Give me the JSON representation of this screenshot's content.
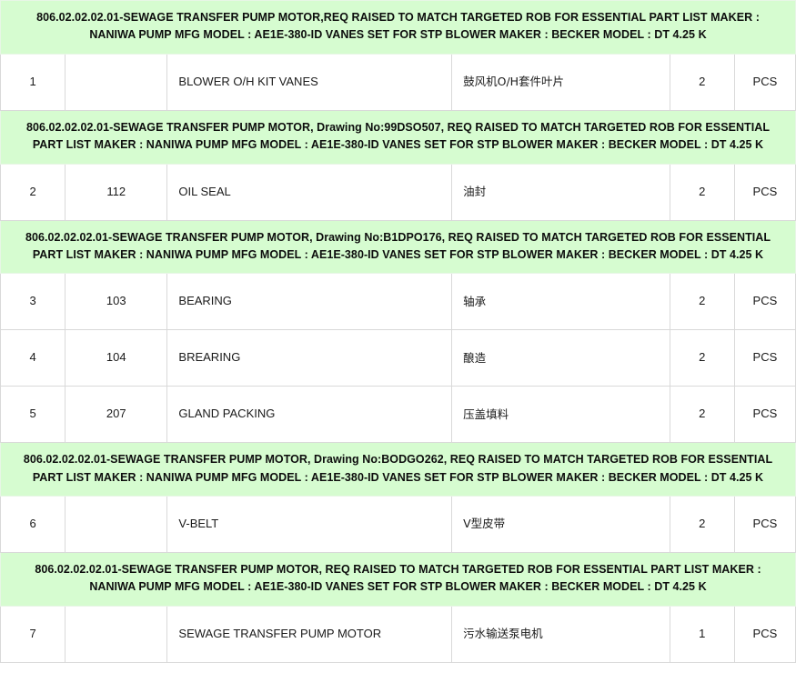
{
  "document": {
    "type": "parts-requisition-table",
    "colors": {
      "group_header_background": "#d6fcd0",
      "row_background": "#ffffff",
      "row_border": "#d9d9d9",
      "text": "#1a1a1a"
    }
  },
  "columns": [
    {
      "key": "line",
      "label": ""
    },
    {
      "key": "item",
      "label": ""
    },
    {
      "key": "desc",
      "label": ""
    },
    {
      "key": "cn",
      "label": ""
    },
    {
      "key": "qty",
      "label": ""
    },
    {
      "key": "unit",
      "label": ""
    }
  ],
  "groups": [
    {
      "header": "806.02.02.02.01-SEWAGE TRANSFER PUMP MOTOR,REQ RAISED TO MATCH TARGETED ROB FOR ESSENTIAL PART LIST MAKER : NANIWA PUMP MFG MODEL : AE1E-380-ID VANES SET FOR STP BLOWER MAKER : BECKER MODEL : DT 4.25 K",
      "rows": [
        {
          "line": "1",
          "item": "",
          "desc": "BLOWER O/H KIT VANES",
          "cn": "鼓风机O/H套件叶片",
          "qty": "2",
          "unit": "PCS"
        }
      ]
    },
    {
      "header": "806.02.02.02.01-SEWAGE TRANSFER PUMP MOTOR, Drawing No:99DSO507, REQ RAISED TO MATCH TARGETED ROB FOR ESSENTIAL PART LIST MAKER : NANIWA PUMP MFG MODEL : AE1E-380-ID VANES SET FOR STP BLOWER MAKER : BECKER MODEL : DT 4.25 K",
      "rows": [
        {
          "line": "2",
          "item": "112",
          "desc": "OIL SEAL",
          "cn": "油封",
          "qty": "2",
          "unit": "PCS"
        }
      ]
    },
    {
      "header": "806.02.02.02.01-SEWAGE TRANSFER PUMP MOTOR, Drawing No:B1DPO176, REQ RAISED TO MATCH TARGETED ROB FOR ESSENTIAL PART LIST MAKER : NANIWA PUMP MFG MODEL : AE1E-380-ID VANES SET FOR STP BLOWER MAKER : BECKER MODEL : DT 4.25 K",
      "rows": [
        {
          "line": "3",
          "item": "103",
          "desc": "BEARING",
          "cn": "轴承",
          "qty": "2",
          "unit": "PCS"
        },
        {
          "line": "4",
          "item": "104",
          "desc": "BREARING",
          "cn": "酿造",
          "qty": "2",
          "unit": "PCS"
        },
        {
          "line": "5",
          "item": "207",
          "desc": "GLAND PACKING",
          "cn": "压盖填料",
          "qty": "2",
          "unit": "PCS"
        }
      ]
    },
    {
      "header": "806.02.02.02.01-SEWAGE TRANSFER PUMP MOTOR, Drawing No:BODGO262, REQ RAISED TO MATCH TARGETED ROB FOR ESSENTIAL PART LIST MAKER : NANIWA PUMP MFG MODEL : AE1E-380-ID VANES SET FOR STP BLOWER MAKER : BECKER MODEL : DT 4.25 K",
      "rows": [
        {
          "line": "6",
          "item": "",
          "desc": "V-BELT",
          "cn": "V型皮带",
          "qty": "2",
          "unit": "PCS"
        }
      ]
    },
    {
      "header": "806.02.02.02.01-SEWAGE TRANSFER PUMP MOTOR, REQ RAISED TO MATCH TARGETED ROB FOR ESSENTIAL PART LIST MAKER : NANIWA PUMP MFG MODEL : AE1E-380-ID VANES SET FOR STP BLOWER MAKER : BECKER MODEL : DT 4.25 K",
      "rows": [
        {
          "line": "7",
          "item": "",
          "desc": "SEWAGE TRANSFER PUMP MOTOR",
          "cn": "污水输送泵电机",
          "qty": "1",
          "unit": "PCS"
        }
      ]
    }
  ]
}
